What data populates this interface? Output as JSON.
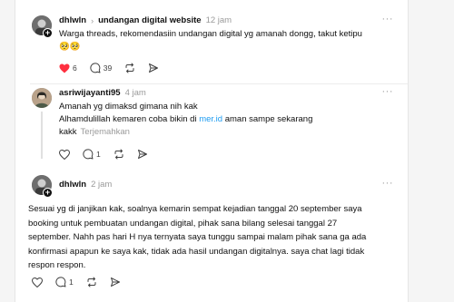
{
  "posts": [
    {
      "username": "dhlwln",
      "topic": "undangan digital website",
      "time": "12 jam",
      "text": "Warga threads, rekomendasiin undangan digital yg amanah dongg, takut ketipu",
      "emoji": "🥺🥺",
      "likes": "6",
      "replies": "39",
      "liked": true
    },
    {
      "username": "asriwijayanti95",
      "time": "4 jam",
      "line1": "Amanah yg dimaksd gimana nih kak",
      "line2_before": "Alhamdulillah kemaren coba bikin di ",
      "line2_link": "mer.id",
      "line2_after": " aman sampe sekarang",
      "line3": "kakk",
      "translate": "Terjemahkan",
      "replies": "1"
    },
    {
      "username": "dhlwln",
      "time": "2 jam",
      "lines": [
        "Sesuai yg di janjikan kak, soalnya kemarin sempat kejadian tanggal 20 september saya",
        "booking untuk pembuatan undangan digital, pihak sana bilang selesai tanggal 27",
        "september. Nahh pas hari H nya ternyata saya tunggu sampai malam pihak sana ga ada",
        "konfirmasi apapun ke saya kak, tidak ada hasil undangan digitalnya. saya chat lagi tidak",
        "respon respon."
      ],
      "replies": "1"
    }
  ],
  "more_glyph": "···",
  "chevron": "›",
  "colors": {
    "like": "#ff3040",
    "link": "#1d9bf0",
    "muted": "#9a9a9a"
  }
}
